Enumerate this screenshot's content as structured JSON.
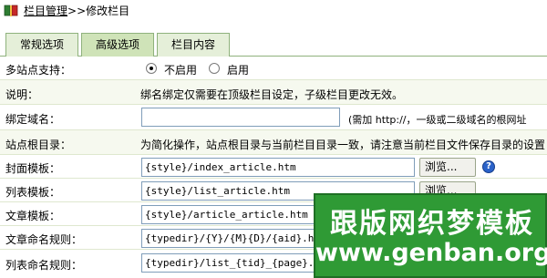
{
  "breadcrumb": {
    "icon": "book-icon",
    "link": "栏目管理",
    "separator": ">>",
    "current": "修改栏目"
  },
  "tabs": [
    {
      "label": "常规选项",
      "active": false
    },
    {
      "label": "高级选项",
      "active": true
    },
    {
      "label": "栏目内容",
      "active": false
    }
  ],
  "form": {
    "multisite": {
      "label": "多站点支持：",
      "options": [
        {
          "label": "不启用",
          "selected": true
        },
        {
          "label": "启用",
          "selected": false
        }
      ]
    },
    "note": {
      "label": "说明：",
      "text": "绑名绑定仅需要在顶级栏目设定，子级栏目更改无效。"
    },
    "domain": {
      "label": "绑定域名：",
      "value": "",
      "hint": "(需加 http://，一级或二级域名的根网址"
    },
    "siteroot": {
      "label": "站点根目录：",
      "text": "为简化操作，站点根目录与当前栏目目录一致，请注意当前栏目文件保存目录的设置"
    },
    "cover_template": {
      "label": "封面模板：",
      "value": "{style}/index_article.htm",
      "browse": "浏览...",
      "help": "?"
    },
    "list_template": {
      "label": "列表模板：",
      "value": "{style}/list_article.htm",
      "browse": "浏览..."
    },
    "article_template": {
      "label": "文章模板：",
      "value": "{style}/article_article.htm"
    },
    "article_naming": {
      "label": "文章命名规则：",
      "value": "{typedir}/{Y}/{M}{D}/{aid}.html"
    },
    "list_naming": {
      "label": "列表命名规则：",
      "value": "{typedir}/list_{tid}_{page}.html"
    }
  },
  "watermark": {
    "line1": "跟版网织梦模板",
    "line2": "www.genban.org"
  },
  "colors": {
    "tab_bg": "#e5efd9",
    "tab_active": "#cfe3b8",
    "border": "#8fb27d",
    "watermark_bg": "#2f9a35"
  }
}
